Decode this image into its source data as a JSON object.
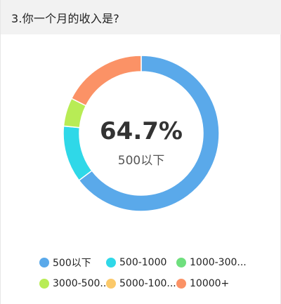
{
  "question": {
    "title": "3.你一个月的收入是?"
  },
  "center": {
    "value": "64.7%",
    "label": "500以下"
  },
  "chart_data": {
    "type": "pie",
    "categories": [
      "500以下",
      "500-1000",
      "1000-300...",
      "3000-500...",
      "5000-100...",
      "10000+"
    ],
    "values": [
      64.7,
      11.8,
      0,
      5.9,
      0,
      17.6
    ],
    "colors": [
      "#5aa9ea",
      "#2fd8e8",
      "#6fdf7e",
      "#b8ec55",
      "#fbc96a",
      "#fb9266"
    ],
    "legend_position": "bottom",
    "donut": true
  }
}
